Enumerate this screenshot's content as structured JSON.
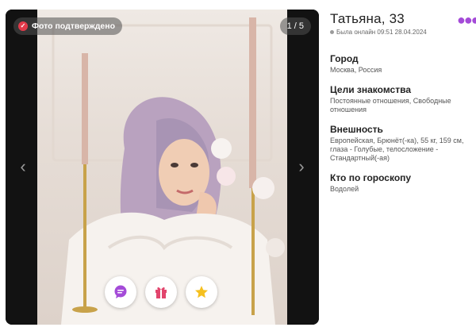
{
  "photo": {
    "verified_label": "Фото подтверждено",
    "counter": "1 / 5",
    "prev_arrow": "‹",
    "next_arrow": "›"
  },
  "actions": [
    {
      "name": "message",
      "icon": "chat-bubble-icon",
      "color": "#a44bd8"
    },
    {
      "name": "gift",
      "icon": "gift-icon",
      "color": "#e2456d"
    },
    {
      "name": "favorite",
      "icon": "star-icon",
      "color": "#f5c01f"
    }
  ],
  "profile": {
    "name": "Татьяна, 33",
    "status": "Была онлайн 09:51 28.04.2024",
    "more_icon": "more-dots-icon",
    "accent_color": "#a44bd8",
    "sections": [
      {
        "title": "Город",
        "value": "Москва, Россия"
      },
      {
        "title": "Цели знакомства",
        "value": "Постоянные отношения, Свободные отношения"
      },
      {
        "title": "Внешность",
        "value": "Европейская, Брюнёт(-ка), 55 кг, 159 см, глаза - Голубые, телосложение - Стандартный(-ая)"
      },
      {
        "title": "Кто по гороскопу",
        "value": "Водолей"
      }
    ]
  }
}
